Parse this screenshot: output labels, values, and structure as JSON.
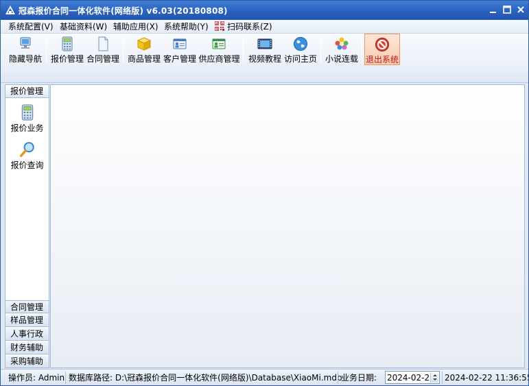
{
  "window": {
    "title": "冠森报价合同一体化软件(网络版) v6.03(20180808)",
    "controls": {
      "minimize": "minimize-icon",
      "restore": "restore-icon",
      "close": "close-icon"
    }
  },
  "menubar": {
    "items": [
      "系统配置(V)",
      "基础资料(W)",
      "辅助应用(X)",
      "系统帮助(Y)"
    ],
    "scan_label": "扫码联系(Z)"
  },
  "toolbar": {
    "buttons": [
      {
        "label": "隐藏导航",
        "icon": "hide-nav-icon"
      },
      {
        "label": "报价管理",
        "icon": "calculator-icon"
      },
      {
        "label": "合同管理",
        "icon": "document-icon"
      },
      {
        "label": "商品管理",
        "icon": "box-icon"
      },
      {
        "label": "客户管理",
        "icon": "customer-card-icon"
      },
      {
        "label": "供应商管理",
        "icon": "supplier-card-icon"
      },
      {
        "label": "视频教程",
        "icon": "video-icon"
      },
      {
        "label": "访问主页",
        "icon": "globe-icon"
      },
      {
        "label": "小说连载",
        "icon": "flower-icon"
      },
      {
        "label": "退出系统",
        "icon": "exit-icon"
      }
    ]
  },
  "sidenav": {
    "active_group": "报价管理",
    "tiles": [
      {
        "label": "报价业务",
        "icon": "calculator-icon"
      },
      {
        "label": "报价查询",
        "icon": "magnifier-icon"
      }
    ],
    "groups": [
      "合同管理",
      "样品管理",
      "人事行政",
      "财务辅助",
      "采购辅助"
    ]
  },
  "statusbar": {
    "operator": "操作员: Admin",
    "db_path": "数据库路径: D:\\冠森报价合同一体化软件(网络版)\\Database\\XiaoMi.mdb",
    "biz_date_label": "业务日期:",
    "biz_date_value": "2024-02-22",
    "datetime": "2024-02-22 11:36:55"
  },
  "colors": {
    "titlebar": "#2a63bf",
    "accent_exit": "#b81616",
    "panel_border": "#a6b9d6"
  }
}
